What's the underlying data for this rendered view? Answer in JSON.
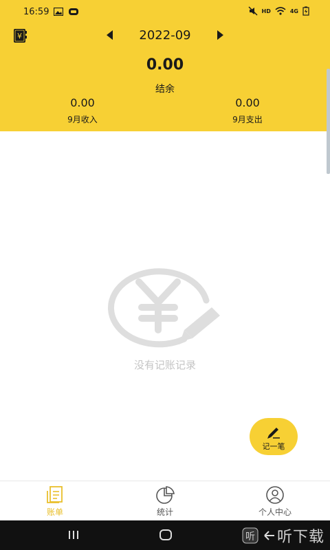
{
  "status_bar": {
    "time": "16:59",
    "icons": [
      "image-icon",
      "notification-badge-icon",
      "mute-icon",
      "hd-icon",
      "wifi-icon",
      "signal-4g-icon",
      "battery-charging-icon"
    ],
    "hd_label": "HD",
    "network_label": "4G"
  },
  "header": {
    "book_icon": "ledger-book-icon",
    "month": "2022-09",
    "balance_value": "0.00",
    "balance_label": "结余",
    "income_value": "0.00",
    "income_label": "9月收入",
    "expense_value": "0.00",
    "expense_label": "9月支出"
  },
  "empty_state": {
    "icon": "yen-pencil-icon",
    "text": "没有记账记录"
  },
  "fab": {
    "icon": "pencil-icon",
    "label": "记一笔"
  },
  "tabbar": {
    "tabs": [
      {
        "label": "账单",
        "icon": "bill-icon",
        "active": true
      },
      {
        "label": "统计",
        "icon": "pie-chart-icon",
        "active": false
      },
      {
        "label": "个人中心",
        "icon": "user-icon",
        "active": false
      }
    ]
  },
  "watermark": {
    "text": "听下载"
  },
  "colors": {
    "accent": "#F7D034",
    "active_tab": "#E9BF2B",
    "empty_gray": "#dedede",
    "navbar": "#111111"
  }
}
